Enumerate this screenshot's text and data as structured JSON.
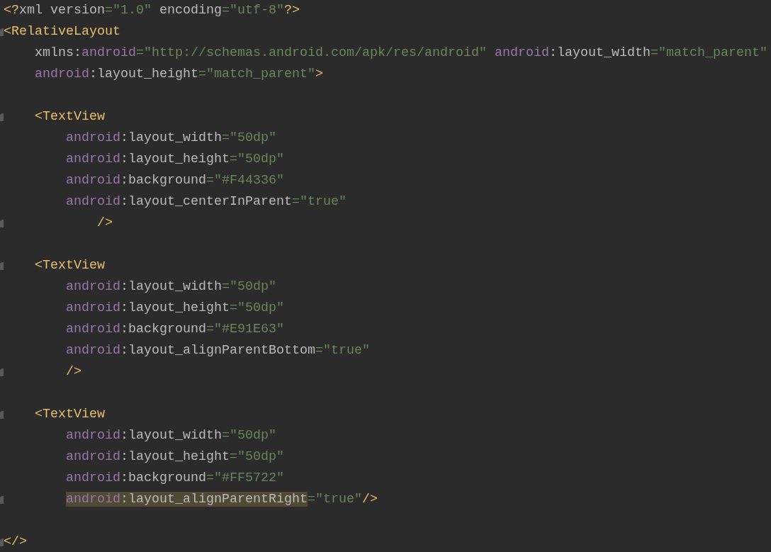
{
  "lines": [
    {
      "fold": false,
      "tokens": [
        {
          "kind": "tag",
          "text": "<?"
        },
        {
          "kind": "attr",
          "text": "xml version"
        },
        {
          "kind": "string",
          "text": "=\"1.0\""
        },
        {
          "kind": "attr",
          "text": " encoding"
        },
        {
          "kind": "string",
          "text": "=\"utf-8\""
        },
        {
          "kind": "tag",
          "text": "?>"
        }
      ]
    },
    {
      "fold": true,
      "tokens": [
        {
          "kind": "tag",
          "text": "<RelativeLayout"
        }
      ]
    },
    {
      "fold": false,
      "tokens": [
        {
          "kind": "attr",
          "text": "    xmlns:"
        },
        {
          "kind": "ns",
          "text": "android"
        },
        {
          "kind": "string",
          "text": "=\"http://schemas.android.com/apk/res/android\""
        },
        {
          "kind": "ns",
          "text": " android"
        },
        {
          "kind": "attr",
          "text": ":layout_width"
        },
        {
          "kind": "string",
          "text": "=\"match_parent\""
        }
      ]
    },
    {
      "fold": false,
      "tokens": [
        {
          "kind": "ns",
          "text": "    android"
        },
        {
          "kind": "attr",
          "text": ":layout_height"
        },
        {
          "kind": "string",
          "text": "=\"match_parent\""
        },
        {
          "kind": "tag",
          "text": ">"
        }
      ]
    },
    {
      "fold": false
    },
    {
      "fold": true,
      "tokens": [
        {
          "kind": "tag",
          "text": "    <TextView"
        }
      ]
    },
    {
      "fold": false,
      "tokens": [
        {
          "kind": "ns",
          "text": "        android"
        },
        {
          "kind": "attr",
          "text": ":layout_width"
        },
        {
          "kind": "string",
          "text": "=\"50dp\""
        }
      ]
    },
    {
      "fold": false,
      "tokens": [
        {
          "kind": "ns",
          "text": "        android"
        },
        {
          "kind": "attr",
          "text": ":layout_height"
        },
        {
          "kind": "string",
          "text": "=\"50dp\""
        }
      ]
    },
    {
      "fold": false,
      "tokens": [
        {
          "kind": "ns",
          "text": "        android"
        },
        {
          "kind": "attr",
          "text": ":background"
        },
        {
          "kind": "string",
          "text": "=\"#F44336\""
        }
      ]
    },
    {
      "fold": false,
      "tokens": [
        {
          "kind": "ns",
          "text": "        android"
        },
        {
          "kind": "attr",
          "text": ":layout_centerInParent"
        },
        {
          "kind": "string",
          "text": "=\"true\""
        }
      ]
    },
    {
      "fold": true,
      "tokens": [
        {
          "kind": "tag",
          "text": "            />"
        }
      ]
    },
    {
      "fold": false
    },
    {
      "fold": true,
      "tokens": [
        {
          "kind": "tag",
          "text": "    <TextView"
        }
      ]
    },
    {
      "fold": false,
      "tokens": [
        {
          "kind": "ns",
          "text": "        android"
        },
        {
          "kind": "attr",
          "text": ":layout_width"
        },
        {
          "kind": "string",
          "text": "=\"50dp\""
        }
      ]
    },
    {
      "fold": false,
      "tokens": [
        {
          "kind": "ns",
          "text": "        android"
        },
        {
          "kind": "attr",
          "text": ":layout_height"
        },
        {
          "kind": "string",
          "text": "=\"50dp\""
        }
      ]
    },
    {
      "fold": false,
      "tokens": [
        {
          "kind": "ns",
          "text": "        android"
        },
        {
          "kind": "attr",
          "text": ":background"
        },
        {
          "kind": "string",
          "text": "=\"#E91E63\""
        }
      ]
    },
    {
      "fold": false,
      "tokens": [
        {
          "kind": "ns",
          "text": "        android"
        },
        {
          "kind": "attr",
          "text": ":layout_alignParentBottom"
        },
        {
          "kind": "string",
          "text": "=\"true\""
        }
      ]
    },
    {
      "fold": true,
      "tokens": [
        {
          "kind": "tag",
          "text": "        />"
        }
      ]
    },
    {
      "fold": false
    },
    {
      "fold": true,
      "tokens": [
        {
          "kind": "tag",
          "text": "    <TextView"
        }
      ]
    },
    {
      "fold": false,
      "tokens": [
        {
          "kind": "ns",
          "text": "        android"
        },
        {
          "kind": "attr",
          "text": ":layout_width"
        },
        {
          "kind": "string",
          "text": "=\"50dp\""
        }
      ]
    },
    {
      "fold": false,
      "tokens": [
        {
          "kind": "ns",
          "text": "        android"
        },
        {
          "kind": "attr",
          "text": ":layout_height"
        },
        {
          "kind": "string",
          "text": "=\"50dp\""
        }
      ]
    },
    {
      "fold": false,
      "tokens": [
        {
          "kind": "ns",
          "text": "        android"
        },
        {
          "kind": "attr",
          "text": ":background"
        },
        {
          "kind": "string",
          "text": "=\"#FF5722\""
        }
      ]
    },
    {
      "fold": true,
      "tokens": [
        {
          "kind": "ns",
          "text": "        android",
          "highlighted": true
        },
        {
          "kind": "attr",
          "text": ":layout_alignParentRight",
          "highlighted": true
        },
        {
          "kind": "string",
          "text": "=\"true\""
        },
        {
          "kind": "tag",
          "text": "/>"
        }
      ]
    },
    {
      "fold": false
    },
    {
      "fold": true,
      "tokens": [
        {
          "kind": "tag",
          "text": "</>"
        }
      ]
    }
  ]
}
